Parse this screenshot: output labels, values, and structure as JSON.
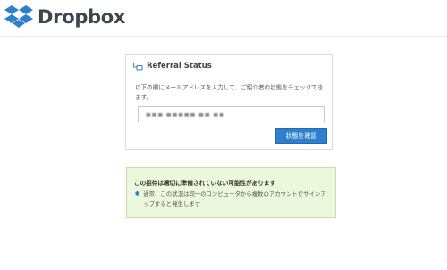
{
  "header": {
    "logo_text": "Dropbox"
  },
  "referral_card": {
    "title": "Referral Status",
    "description": "以下の欄にメールアドレスを入力して、ご紹介者の状態をチェックできます。",
    "email_value": "■■■ ■■■■■ ■■ ■■",
    "check_button_label": "状態を確認"
  },
  "notice": {
    "title": "この招待は適切に準備されていない可能性があります",
    "item": "通常、この状況は同一のコンピュータから複数のアカウントでサインアップすると発生します"
  },
  "colors": {
    "brand_blue": "#2f7fd0",
    "notice_bg": "#ecf8dc"
  },
  "icons": {
    "logo": "dropbox-logo-icon",
    "referral": "referral-status-icon"
  }
}
